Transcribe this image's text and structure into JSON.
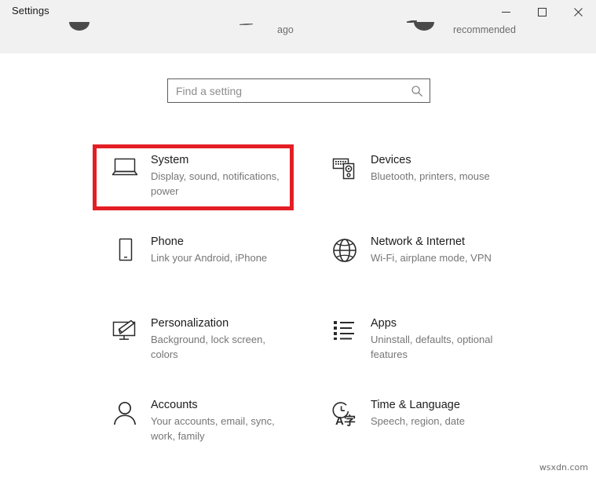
{
  "window": {
    "title": "Settings",
    "controls": {
      "minimize": "minimize",
      "maximize": "maximize",
      "close": "close"
    }
  },
  "header_remnants": {
    "text_middle": "ago",
    "text_right": "recommended"
  },
  "search": {
    "placeholder": "Find a setting",
    "value": "",
    "icon": "search-icon"
  },
  "annotation": {
    "color": "#e31e24",
    "target": "System"
  },
  "tiles": [
    {
      "title": "System",
      "subtitle": "Display, sound, notifications, power",
      "icon": "laptop-icon",
      "highlighted": true
    },
    {
      "title": "Devices",
      "subtitle": "Bluetooth, printers, mouse",
      "icon": "devices-icon",
      "highlighted": false
    },
    {
      "title": "Phone",
      "subtitle": "Link your Android, iPhone",
      "icon": "phone-icon",
      "highlighted": false
    },
    {
      "title": "Network & Internet",
      "subtitle": "Wi-Fi, airplane mode, VPN",
      "icon": "globe-icon",
      "highlighted": false
    },
    {
      "title": "Personalization",
      "subtitle": "Background, lock screen, colors",
      "icon": "personalization-icon",
      "highlighted": false
    },
    {
      "title": "Apps",
      "subtitle": "Uninstall, defaults, optional features",
      "icon": "apps-list-icon",
      "highlighted": false
    },
    {
      "title": "Accounts",
      "subtitle": "Your accounts, email, sync, work, family",
      "icon": "person-icon",
      "highlighted": false
    },
    {
      "title": "Time & Language",
      "subtitle": "Speech, region, date",
      "icon": "time-language-icon",
      "highlighted": false
    }
  ],
  "watermark": "wsxdn.com"
}
